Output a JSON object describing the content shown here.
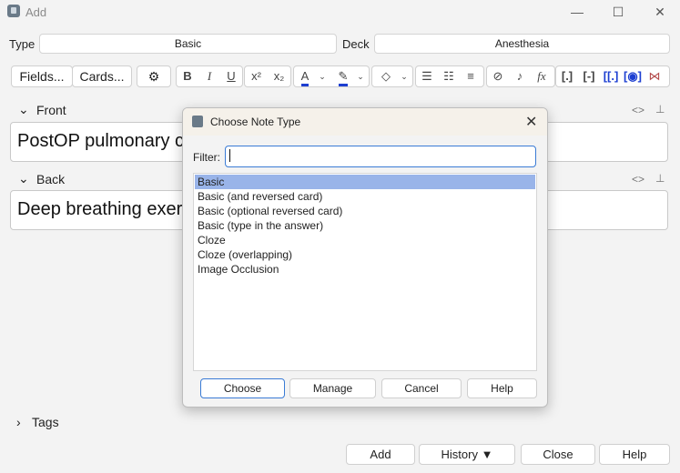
{
  "window": {
    "title": "Add",
    "min_icon": "minimize-icon",
    "max_icon": "maximize-icon",
    "close_icon": "close-icon"
  },
  "selectors": {
    "type_label": "Type",
    "type_value": "Basic",
    "deck_label": "Deck",
    "deck_value": "Anesthesia"
  },
  "toolbar": {
    "fields_label": "Fields...",
    "cards_label": "Cards..."
  },
  "fields": {
    "front": {
      "name": "Front",
      "content": "PostOP pulmonary c"
    },
    "back": {
      "name": "Back",
      "content": "Deep breathing exer"
    }
  },
  "tags": {
    "label": "Tags"
  },
  "bottom": {
    "add": "Add",
    "history": "History ▼",
    "close": "Close",
    "help": "Help"
  },
  "dialog": {
    "title": "Choose Note Type",
    "filter_label": "Filter:",
    "filter_value": "",
    "items": [
      "Basic",
      "Basic (and reversed card)",
      "Basic (optional reversed card)",
      "Basic (type in the answer)",
      "Cloze",
      "Cloze (overlapping)",
      "Image Occlusion"
    ],
    "selected_index": 0,
    "buttons": {
      "choose": "Choose",
      "manage": "Manage",
      "cancel": "Cancel",
      "help": "Help"
    }
  },
  "colors": {
    "accent": "#3a7bd5",
    "selection": "#99b4e9",
    "text_color_bar": "#1d3fd1"
  }
}
